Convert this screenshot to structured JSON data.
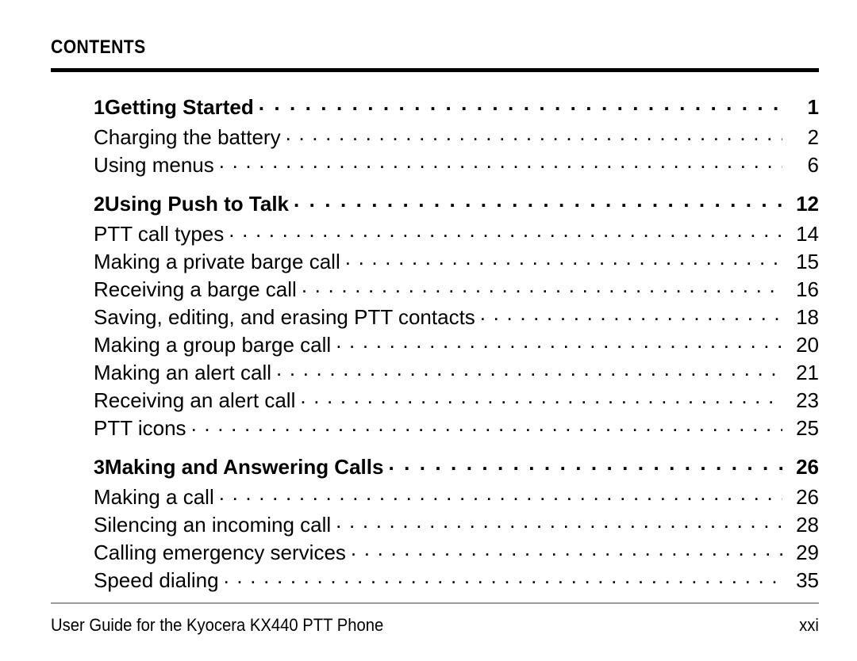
{
  "header": {
    "title": "Contents"
  },
  "toc": {
    "chapters": [
      {
        "number": "1",
        "title": "Getting Started",
        "page": "1",
        "entries": [
          {
            "label": "Charging the battery",
            "page": "2"
          },
          {
            "label": "Using menus",
            "page": "6"
          }
        ]
      },
      {
        "number": "2",
        "title": "Using Push to Talk",
        "page": "12",
        "entries": [
          {
            "label": "PTT call types",
            "page": "14"
          },
          {
            "label": "Making a private barge call",
            "page": "15"
          },
          {
            "label": "Receiving a barge call",
            "page": "16"
          },
          {
            "label": "Saving, editing, and erasing PTT contacts",
            "page": "18"
          },
          {
            "label": "Making a group barge call",
            "page": "20"
          },
          {
            "label": "Making an alert call",
            "page": "21"
          },
          {
            "label": "Receiving an alert call",
            "page": "23"
          },
          {
            "label": "PTT icons",
            "page": "25"
          }
        ]
      },
      {
        "number": "3",
        "title": "Making and Answering Calls",
        "page": "26",
        "entries": [
          {
            "label": "Making a call",
            "page": "26"
          },
          {
            "label": "Silencing an incoming call",
            "page": "28"
          },
          {
            "label": "Calling emergency services",
            "page": "29"
          },
          {
            "label": "Speed dialing",
            "page": "35"
          }
        ]
      }
    ]
  },
  "footer": {
    "text": "User Guide for the Kyocera KX440 PTT Phone",
    "folio": "xxi"
  }
}
